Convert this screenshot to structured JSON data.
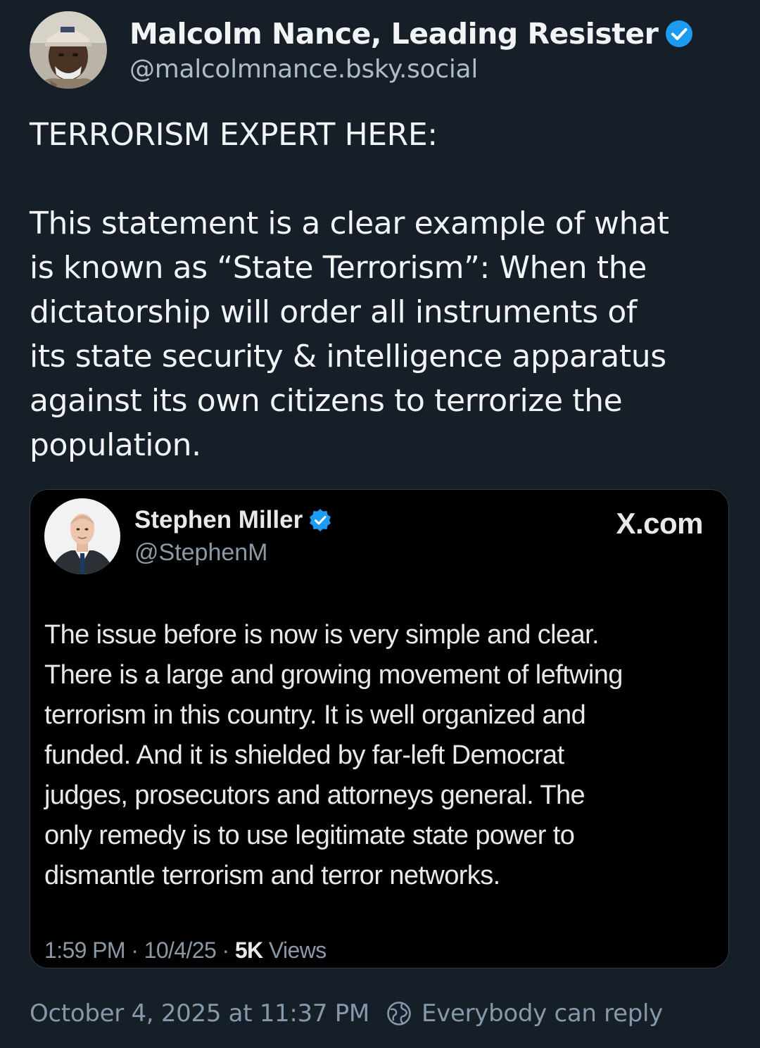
{
  "author": {
    "display_name": "Malcolm Nance, Leading Resister",
    "handle": "@malcolmnance.bsky.social",
    "verified_icon": "verified-badge-icon",
    "avatar": "avatar-photo",
    "badge_color": "#1d9bf0"
  },
  "post": {
    "headline": "TERRORISM EXPERT HERE:",
    "lines": [
      "This statement is a clear example of what",
      "is known as “State Terrorism”: When the",
      "dictatorship will order all instruments of",
      "its state security & intelligence apparatus",
      "against its own citizens to terrorize the",
      "population."
    ]
  },
  "embed": {
    "display_name": "Stephen Miller",
    "handle": "@StephenM",
    "brand": "X.com",
    "verified_icon": "verified-badge-icon",
    "lines": [
      "The issue before is now is very simple and clear.",
      "There is a large and growing movement of leftwing",
      "terrorism in this country. It is well organized and",
      "funded. And it is shielded by far-left Democrat",
      "judges, prosecutors and attorneys general. The",
      "only remedy is to use legitimate state power to",
      "dismantle terrorism and terror networks."
    ],
    "meta": {
      "time": "1:59 PM",
      "date": "10/4/25",
      "separator": " · ",
      "views_count": "5K",
      "views_label": " Views"
    }
  },
  "footer": {
    "timestamp": "October 4, 2025 at 11:37 PM",
    "reply_setting": "Everybody can reply",
    "reply_icon": "globe-icon"
  },
  "colors": {
    "background": "#161e27",
    "embed_background": "#000000",
    "muted_text": "#8698ab",
    "accent": "#1d9bf0"
  }
}
